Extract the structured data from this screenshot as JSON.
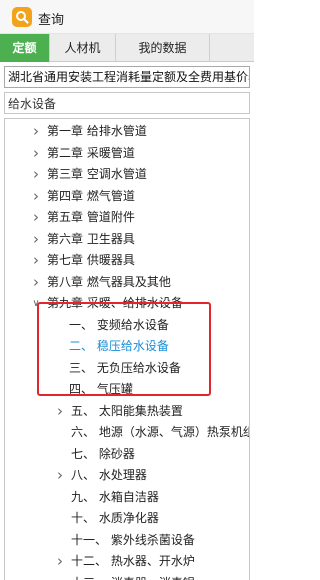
{
  "window": {
    "title": "查询",
    "app_icon": "search-icon"
  },
  "tabs": [
    {
      "label": "定额",
      "active": true
    },
    {
      "label": "人材机",
      "active": false
    },
    {
      "label": "我的数据",
      "active": false
    }
  ],
  "library_select": {
    "value": "湖北省通用安装工程消耗量定额及全费用基价表"
  },
  "search": {
    "value": "给水设备"
  },
  "tree": [
    {
      "label": "第一章  给排水管道",
      "expander": "collapsed"
    },
    {
      "label": "第二章  采暖管道",
      "expander": "collapsed"
    },
    {
      "label": "第三章  空调水管道",
      "expander": "collapsed"
    },
    {
      "label": "第四章  燃气管道",
      "expander": "collapsed"
    },
    {
      "label": "第五章  管道附件",
      "expander": "collapsed"
    },
    {
      "label": "第六章  卫生器具",
      "expander": "collapsed"
    },
    {
      "label": "第七章  供暖器具",
      "expander": "collapsed"
    },
    {
      "label": "第八章  燃气器具及其他",
      "expander": "collapsed"
    },
    {
      "label": "第九章  采暖、给排水设备",
      "expander": "expanded"
    },
    {
      "label": "一、  变频给水设备",
      "expander": "none",
      "selected": false
    },
    {
      "label": "二、  稳压给水设备",
      "expander": "none",
      "selected": true
    },
    {
      "label": "三、  无负压给水设备",
      "expander": "none",
      "selected": false
    },
    {
      "label": "四、  气压罐",
      "expander": "none",
      "selected": false
    },
    {
      "label": "五、  太阳能集热装置",
      "expander": "collapsed"
    },
    {
      "label": "六、  地源（水源、气源）热泵机组",
      "expander": "none"
    },
    {
      "label": "七、  除砂器",
      "expander": "none"
    },
    {
      "label": "八、  水处理器",
      "expander": "collapsed"
    },
    {
      "label": "九、  水箱自洁器",
      "expander": "none"
    },
    {
      "label": "十、  水质净化器",
      "expander": "none"
    },
    {
      "label": "十一、  紫外线杀菌设备",
      "expander": "none"
    },
    {
      "label": "十二、  热水器、开水炉",
      "expander": "collapsed"
    },
    {
      "label": "十三、  消毒器、消毒锅",
      "expander": "collapsed"
    }
  ],
  "colors": {
    "accent_tab": "#4caf50",
    "selected_text": "#1a8fd8",
    "highlight_box": "#e3262a",
    "app_icon": "#f2a31b"
  }
}
